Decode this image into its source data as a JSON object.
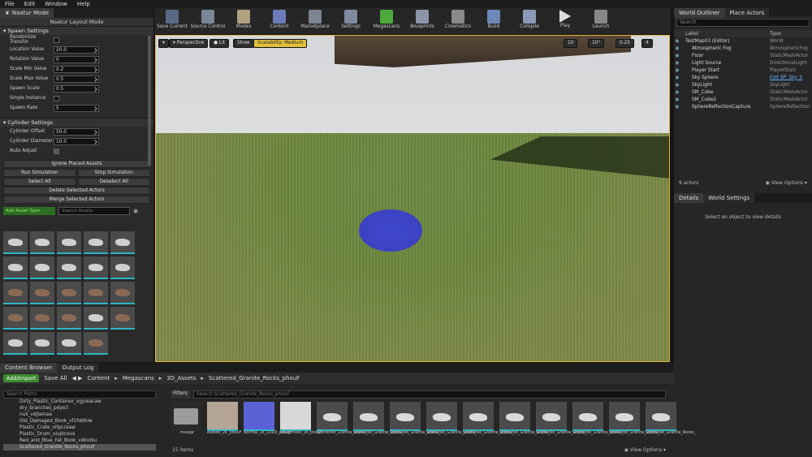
{
  "menu": [
    "File",
    "Edit",
    "Window",
    "Help"
  ],
  "left_tab": "Naatur Mode",
  "mode_title": "Naatur Layout Mode",
  "spawn_settings": {
    "title": "Spawn Settings",
    "rows": [
      {
        "label": "Randomize Transfor",
        "value": null,
        "checkbox": false
      },
      {
        "label": "Location Value",
        "value": "20.0"
      },
      {
        "label": "Rotation Value",
        "value": "0"
      },
      {
        "label": "Scale Min Value",
        "value": "0.2"
      },
      {
        "label": "Scale Max Value",
        "value": "0.5"
      },
      {
        "label": "Spawn Scale",
        "value": "0.5"
      },
      {
        "label": "Single Instance",
        "value": null,
        "checkbox": false
      },
      {
        "label": "Spawn Rate",
        "value": "5"
      }
    ]
  },
  "cylinder_settings": {
    "title": "Cylinder Settings",
    "rows": [
      {
        "label": "Cylinder Offset",
        "value": "50.0"
      },
      {
        "label": "Cylinder Diameter",
        "value": "10.0"
      },
      {
        "label": "Auto Adjust",
        "value": null,
        "checkbox": true
      }
    ]
  },
  "buttons": {
    "ignore": "Ignore Placed Assets",
    "run": "Run Simulation",
    "stop": "Stop Simulation",
    "select_all": "Select All",
    "deselect_all": "Deselect All",
    "delete_sel": "Delete Selected Actors",
    "merge_sel": "Merge Selected Actors"
  },
  "asset_filter": {
    "add": "Add Asset Type",
    "search_placeholder": "Search Assets"
  },
  "toolbar": [
    "Save Current",
    "Source Control",
    "Modes",
    "Content",
    "Marketplace",
    "Settings",
    "Megascans",
    "Blueprints",
    "Cinematics",
    "Build",
    "Compile",
    "Play",
    "Launch"
  ],
  "viewport": {
    "perspective": "Perspective",
    "lit": "Lit",
    "show": "Show",
    "scalability": "Scalability: Medium",
    "grid": "10",
    "angle": "10°",
    "scale": "0.25",
    "cam": "4"
  },
  "outliner": {
    "tab1": "World Outliner",
    "tab2": "Place Actors",
    "search": "Search",
    "col_label": "Label",
    "col_type": "Type",
    "items": [
      {
        "label": "TestMap03 (Editor)",
        "type": "World"
      },
      {
        "label": "Atmospheric Fog",
        "type": "AtmosphericFog"
      },
      {
        "label": "Floor",
        "type": "StaticMeshActor"
      },
      {
        "label": "Light Source",
        "type": "DirectionalLight"
      },
      {
        "label": "Player Start",
        "type": "PlayerStart"
      },
      {
        "label": "Sky Sphere",
        "type": "Edit BP_Sky_S"
      },
      {
        "label": "SkyLight",
        "type": "SkyLight"
      },
      {
        "label": "SM_Cube",
        "type": "StaticMeshActor"
      },
      {
        "label": "SM_Cube2",
        "type": "StaticMeshActor"
      },
      {
        "label": "SphereReflectionCapture",
        "type": "SphereReflection"
      }
    ],
    "count": "9 actors",
    "view_options": "View Options"
  },
  "details": {
    "tab1": "Details",
    "tab2": "World Settings",
    "empty": "Select an object to view details"
  },
  "bottom": {
    "tab1": "Content Browser",
    "tab2": "Output Log",
    "add": "Add/Import",
    "save": "Save All",
    "path": [
      "Content",
      "Megascans",
      "3D_Assets",
      "Scattered_Granite_Rocks_phxuF"
    ],
    "search_paths": "Search Paths",
    "filters": "Filters",
    "search_assets": "Search Scattered_Granite_Rocks_phxuF",
    "folders": [
      "Dirty_Plastic_Container_vgyieacaw",
      "dry_branches_pdye3",
      "null_vdjlainaa",
      "Old_Damaged_Book_vf1fddhiw",
      "Plastic_Crate_vifpccsaw",
      "Plastic_Drum_uiujbcxva",
      "Red_and_Blue_Fat_Book_vdkvbiu",
      "Scattered_Granite_Rocks_phxuF"
    ],
    "assets": [
      "Foliage",
      "Albedo_2K_phxuF",
      "Normal_2K_LOD0_phxuF",
      "Roughness_2K_phxuF",
      "Scattered_Granite_Rocks_",
      "Scattered_Granite_Rocks_",
      "Scattered_Granite_Rocks_",
      "Scattered_Granite_Rocks_",
      "Scattered_Granite_Rocks_",
      "Scattered_Granite_Rocks_",
      "Scattered_Granite_Rocks_",
      "Scattered_Granite_Rocks_",
      "Scattered_Granite_Rocks_",
      "Scattered_Granite_Rocks_"
    ],
    "count": "15 items",
    "view_options": "View Options"
  }
}
